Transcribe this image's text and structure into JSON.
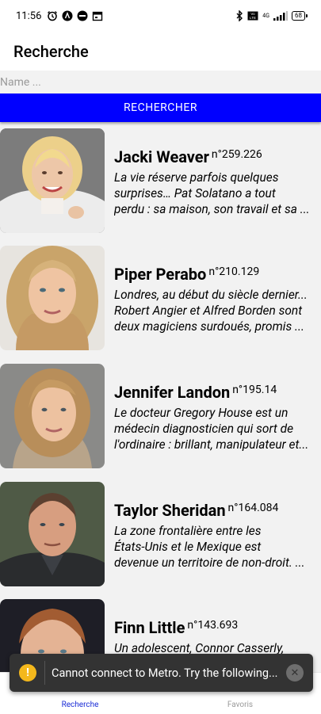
{
  "status_bar": {
    "time": "11:56",
    "network": "4G",
    "battery": "68",
    "icons": [
      "alarm-icon",
      "app-a-icon",
      "app-circle-icon",
      "calendar-icon",
      "bluetooth-icon",
      "volte-icon",
      "signal-icon",
      "battery-icon"
    ]
  },
  "header": {
    "title": "Recherche"
  },
  "search": {
    "placeholder": "Name ...",
    "value": "",
    "button_label": "RECHERCHER",
    "button_color": "#0000ff"
  },
  "results": [
    {
      "name": "Jacki Weaver",
      "score": "n°259.226",
      "lines": [
        "La vie réserve parfois quelques",
        "surprises… Pat Solatano a tout",
        "perdu : sa maison, son travail et sa ..."
      ]
    },
    {
      "name": "Piper Perabo",
      "score": "n°210.129",
      "lines": [
        "Londres, au début du siècle dernier...",
        "Robert Angier et Alfred Borden sont",
        "deux magiciens surdoués, promis ..."
      ]
    },
    {
      "name": "Jennifer Landon",
      "score": "n°195.14",
      "lines": [
        "Le docteur Gregory House est un",
        "médecin diagnosticien qui sort de",
        "l'ordinaire : brillant, manipulateur et..."
      ]
    },
    {
      "name": "Taylor Sheridan",
      "score": "n°164.084",
      "lines": [
        "La zone frontalière entre les",
        "États-Unis et le Mexique est",
        "devenue un territoire de non-droit. ..."
      ]
    },
    {
      "name": "Finn Little",
      "score": "n°143.693",
      "lines": [
        "Un adolescent, Connor Casserly,",
        "",
        ""
      ]
    }
  ],
  "toast": {
    "message": "Cannot connect to Metro.  Try the following..."
  },
  "bottom_nav": {
    "tabs": [
      {
        "label": "Recherche",
        "active": true,
        "color": "#1a2cd6"
      },
      {
        "label": "Favoris",
        "active": false,
        "color": "#9a9a9a"
      }
    ]
  }
}
